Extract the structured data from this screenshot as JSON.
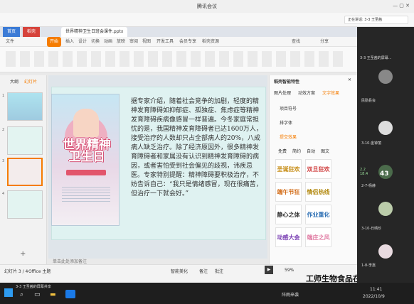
{
  "window": {
    "title": "腾讯会议"
  },
  "meeting_bar": {
    "speaking_label": "正在讲话: 3-3 王圣茜"
  },
  "wps": {
    "tabs": [
      {
        "label": "首页"
      },
      {
        "label": "稻壳"
      },
      {
        "label": "世界精神卫生日班会课件.pptx"
      }
    ],
    "menu": [
      "文件",
      "开始",
      "插入",
      "设计",
      "切换",
      "动画",
      "放映",
      "审阅",
      "视图",
      "开发工具",
      "会员专享",
      "稻壳资源"
    ],
    "active_menu": "开始",
    "search_label": "查找",
    "share_label": "分享"
  },
  "left_panel": {
    "tabs": [
      "大纲",
      "幻灯片"
    ],
    "thumb_numbers": [
      "1",
      "2",
      "3",
      "4"
    ]
  },
  "slide": {
    "poster_title_1": "世界精神",
    "poster_title_2": "卫生日",
    "body_text": "据专家介绍，随着社会竞争的加剧，轻度的精神发育障碍如抑郁症、孤独症、焦虑症等精神发育障碍疾病像感冒一样普遍。今冬家庭常担忧的是，我国精神发育障碍者已达1600万人，接受治疗的人数却只占全部病人的20%，八成病人缺乏治疗。除了经济原因外，很多精神发育障碍者和家属没有认识到精神发育障碍的病因，或者害怕受到社会偏见的歧视，讳疾忌医。专家特别提醒：精神障碍要积极治疗，不妨告诉自己：“我只是情绪感冒，现在很痛苦，但治疗一下就会好。”"
  },
  "right_panel": {
    "header": "稻壳智能特性",
    "tabs": [
      "图片处理",
      "动效方案",
      "文字效果"
    ],
    "sections": [
      "项目符号",
      "排字体",
      "提交效果"
    ],
    "sub_tabs": [
      "免费",
      "简约",
      "自动",
      "图文"
    ],
    "styles": [
      "圣诞狂欢",
      "双旦狂欢",
      "端午节狂",
      "情侣热线",
      "静心之体",
      "作业重化",
      "动感大会",
      "端庄之风"
    ]
  },
  "status": {
    "slide_info": "幻灯片 3 / 4",
    "theme": "Office 主题",
    "notes_prompt": "单击此处添加备注",
    "zoom": "59%",
    "smart_beautify": "智能美化",
    "notes_label": "备注",
    "comment_label": "批注"
  },
  "participants": [
    {
      "name": "3-3 王圣茜的屏幕..."
    },
    {
      "name": "民勤县会"
    },
    {
      "name": "3-10-金钟丽"
    },
    {
      "name": "2-7-杨赫"
    },
    {
      "name": "3-10-日晴珍"
    },
    {
      "name": "1-8-李嘉"
    }
  ],
  "stats": {
    "percent": "43",
    "up": "2.2",
    "down": "18.4"
  },
  "taskbar": {
    "share_label": "3-3 王圣茜的屏幕共享",
    "weather": "阵雨来袭",
    "time": "11:41",
    "date": "2022/10/9"
  },
  "watermark": "工师生物食品在线"
}
